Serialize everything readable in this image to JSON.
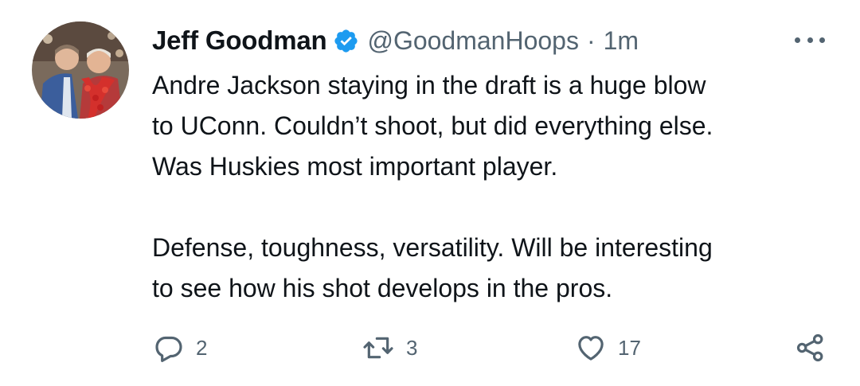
{
  "tweet": {
    "author": {
      "name": "Jeff Goodman",
      "handle": "@GoodmanHoops",
      "separator": "·",
      "time": "1m",
      "verified": true
    },
    "text": {
      "paragraph1_line1": "Andre Jackson staying in the draft is a huge blow",
      "paragraph1_line2": "to UConn. Couldn’t shoot, but did everything else.",
      "paragraph1_line3": "Was Huskies most important player.",
      "paragraph2_line1": "Defense, toughness, versatility. Will be interesting",
      "paragraph2_line2": "to see how his shot develops in the pros."
    },
    "actions": {
      "reply_count": "2",
      "retweet_count": "3",
      "like_count": "17"
    }
  },
  "colors": {
    "text_primary": "#0f1419",
    "text_secondary": "#536471",
    "verified_blue": "#1d9bf0"
  },
  "icons": {
    "more": "more-horizontal-icon",
    "reply": "reply-icon",
    "retweet": "retweet-icon",
    "like": "heart-icon",
    "share": "share-icon",
    "verified": "verified-badge-icon"
  }
}
